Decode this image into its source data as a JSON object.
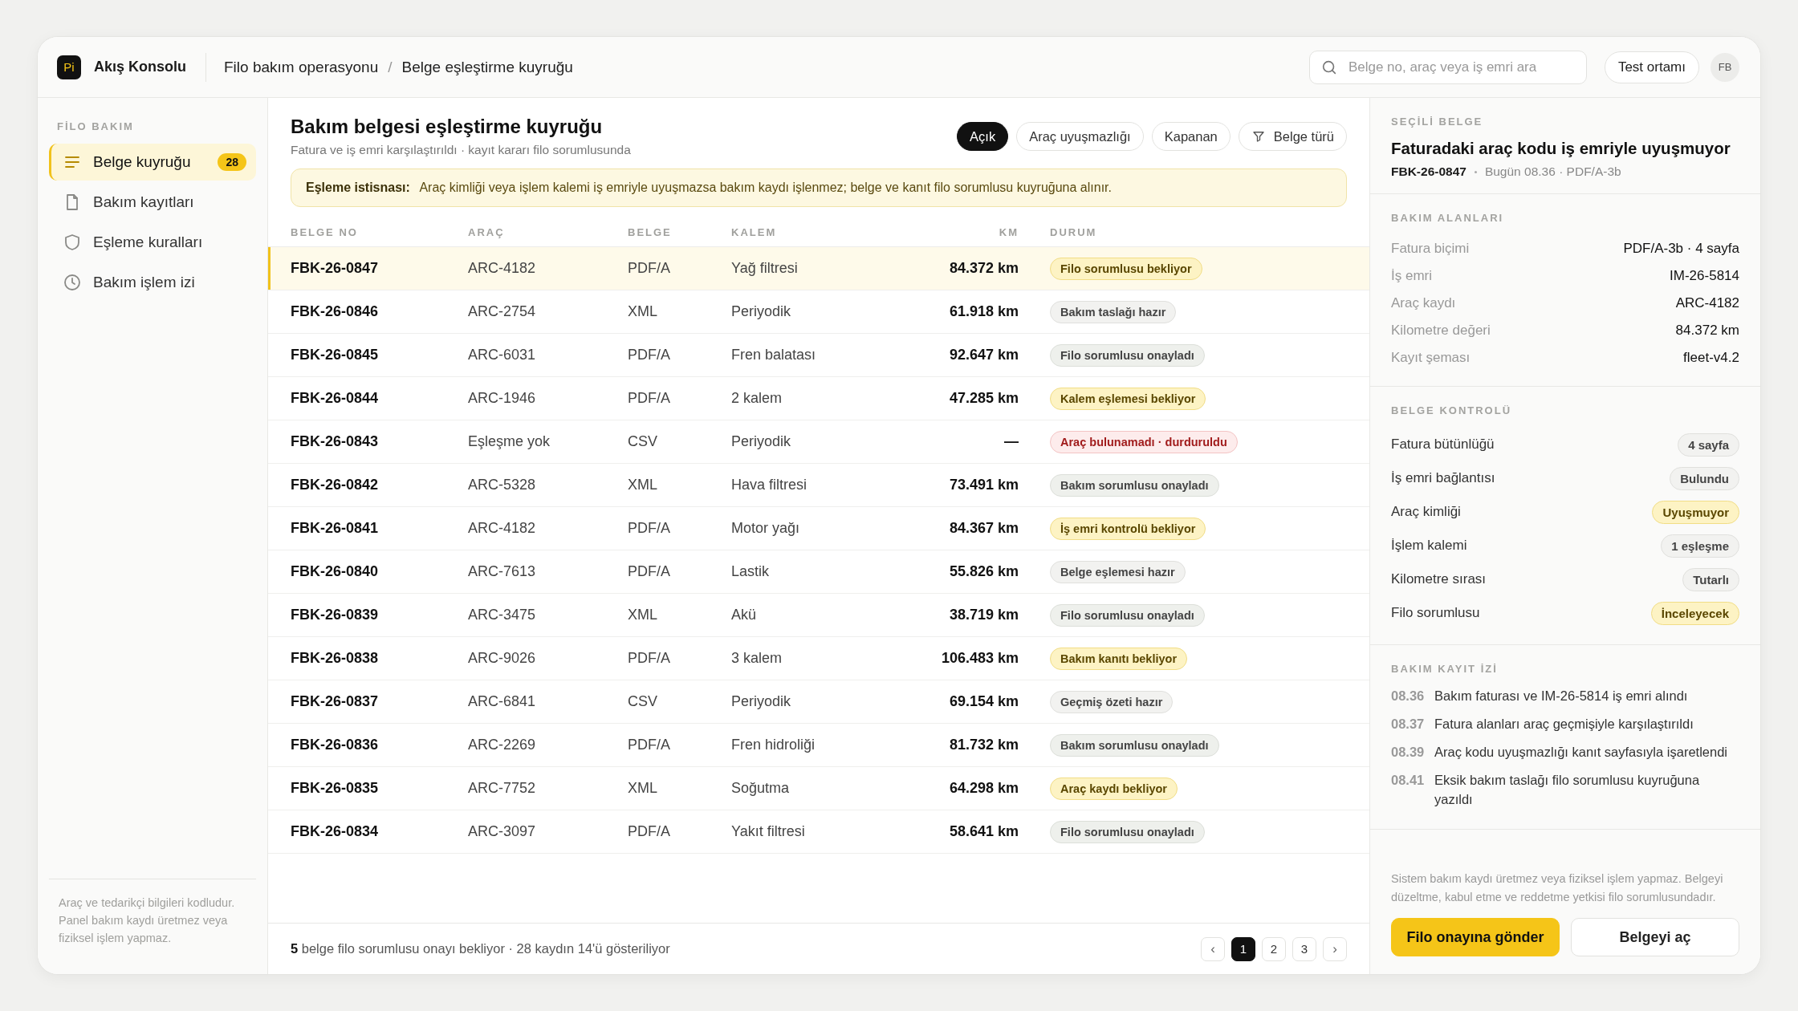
{
  "topbar": {
    "logo": "Pi",
    "app_name": "Akış Konsolu",
    "breadcrumb": [
      {
        "label": "Filo bakım operasyonu"
      },
      {
        "label": "Belge eşleştirme kuyruğu"
      }
    ],
    "breadcrumb_separator": "/",
    "search": {
      "placeholder": "Belge no, araç veya iş emri ara"
    },
    "environment": "Test ortamı",
    "avatar": "FB"
  },
  "sidebar": {
    "section": "FİLO BAKIM",
    "items": [
      {
        "label": "Belge kuyruğu",
        "count": "28",
        "selected": true
      },
      {
        "label": "Bakım kayıtları",
        "selected": false
      },
      {
        "label": "Eşleme kuralları",
        "selected": false
      },
      {
        "label": "Bakım işlem izi",
        "selected": false
      }
    ],
    "note": "Araç ve tedarikçi bilgileri kodludur. Panel bakım kaydı üretmez veya fiziksel işlem yapmaz."
  },
  "main": {
    "title": "Bakım belgesi eşleştirme kuyruğu",
    "subtitle": "Fatura ve iş emri karşılaştırıldı · kayıt kararı filo sorumlusunda",
    "filters": [
      {
        "label": "Açık",
        "selected": true,
        "kind": "chip"
      },
      {
        "label": "Araç uyuşmazlığı",
        "selected": false,
        "kind": "chip"
      },
      {
        "label": "Kapanan",
        "selected": false,
        "kind": "chip"
      },
      {
        "label": "Belge türü",
        "selected": false,
        "kind": "filter"
      }
    ],
    "alert": "**Eşleme istisnası:** Araç kimliği veya işlem kalemi iş emriyle uyuşmazsa bakım kaydı işlenmez; belge ve kanıt filo sorumlusu kuyruğuna alınır.",
    "table": {
      "columns": [
        "BELGE NO",
        "ARAÇ",
        "BELGE",
        "KALEM",
        "KM",
        "DURUM"
      ],
      "rows": [
        {
          "no": "FBK-26-0847",
          "vehicle": "ARC-4182",
          "doc": "PDF/A",
          "item": "Yağ filtresi",
          "km": "84.372 km",
          "status": "Filo sorumlusu bekliyor",
          "kind": "warn",
          "selected": true
        },
        {
          "no": "FBK-26-0846",
          "vehicle": "ARC-2754",
          "doc": "XML",
          "item": "Periyodik",
          "km": "61.918 km",
          "status": "Bakım taslağı hazır",
          "kind": "neutral",
          "selected": false
        },
        {
          "no": "FBK-26-0845",
          "vehicle": "ARC-6031",
          "doc": "PDF/A",
          "item": "Fren balatası",
          "km": "92.647 km",
          "status": "Filo sorumlusu onayladı",
          "kind": "done",
          "selected": false
        },
        {
          "no": "FBK-26-0844",
          "vehicle": "ARC-1946",
          "doc": "PDF/A",
          "item": "2 kalem",
          "km": "47.285 km",
          "status": "Kalem eşlemesi bekliyor",
          "kind": "warn",
          "selected": false
        },
        {
          "no": "FBK-26-0843",
          "vehicle": "Eşleşme yok",
          "doc": "CSV",
          "item": "Periyodik",
          "km": "—",
          "status": "Araç bulunamadı · durduruldu",
          "kind": "danger",
          "selected": false
        },
        {
          "no": "FBK-26-0842",
          "vehicle": "ARC-5328",
          "doc": "XML",
          "item": "Hava filtresi",
          "km": "73.491 km",
          "status": "Bakım sorumlusu onayladı",
          "kind": "done",
          "selected": false
        },
        {
          "no": "FBK-26-0841",
          "vehicle": "ARC-4182",
          "doc": "PDF/A",
          "item": "Motor yağı",
          "km": "84.367 km",
          "status": "İş emri kontrolü bekliyor",
          "kind": "warn",
          "selected": false
        },
        {
          "no": "FBK-26-0840",
          "vehicle": "ARC-7613",
          "doc": "PDF/A",
          "item": "Lastik",
          "km": "55.826 km",
          "status": "Belge eşlemesi hazır",
          "kind": "neutral",
          "selected": false
        },
        {
          "no": "FBK-26-0839",
          "vehicle": "ARC-3475",
          "doc": "XML",
          "item": "Akü",
          "km": "38.719 km",
          "status": "Filo sorumlusu onayladı",
          "kind": "done",
          "selected": false
        },
        {
          "no": "FBK-26-0838",
          "vehicle": "ARC-9026",
          "doc": "PDF/A",
          "item": "3 kalem",
          "km": "106.483 km",
          "status": "Bakım kanıtı bekliyor",
          "kind": "warn",
          "selected": false
        },
        {
          "no": "FBK-26-0837",
          "vehicle": "ARC-6841",
          "doc": "CSV",
          "item": "Periyodik",
          "km": "69.154 km",
          "status": "Geçmiş özeti hazır",
          "kind": "neutral",
          "selected": false
        },
        {
          "no": "FBK-26-0836",
          "vehicle": "ARC-2269",
          "doc": "PDF/A",
          "item": "Fren hidroliği",
          "km": "81.732 km",
          "status": "Bakım sorumlusu onayladı",
          "kind": "done",
          "selected": false
        },
        {
          "no": "FBK-26-0835",
          "vehicle": "ARC-7752",
          "doc": "XML",
          "item": "Soğutma",
          "km": "64.298 km",
          "status": "Araç kaydı bekliyor",
          "kind": "warn",
          "selected": false
        },
        {
          "no": "FBK-26-0834",
          "vehicle": "ARC-3097",
          "doc": "PDF/A",
          "item": "Yakıt filtresi",
          "km": "58.641 km",
          "status": "Filo sorumlusu onayladı",
          "kind": "done",
          "selected": false
        }
      ]
    },
    "footer": "**5** belge filo sorumlusu onayı bekliyor · 28 kaydın 14'ü gösteriliyor",
    "pagination": [
      {
        "label": "‹",
        "kind": "arrow",
        "selected": false
      },
      {
        "label": "1",
        "kind": "page",
        "selected": true
      },
      {
        "label": "2",
        "kind": "page",
        "selected": false
      },
      {
        "label": "3",
        "kind": "page",
        "selected": false
      },
      {
        "label": "›",
        "kind": "arrow",
        "selected": false
      }
    ]
  },
  "detail": {
    "section": "SEÇİLİ BELGE",
    "title": "Faturadaki araç kodu iş emriyle uyuşmuyor",
    "doc_no": "FBK-26-0847",
    "meta": "Bugün 08.36 · PDF/A-3b",
    "fields_title": "BAKIM ALANLARI",
    "fields": [
      {
        "label": "Fatura biçimi",
        "value": "PDF/A-3b · 4 sayfa"
      },
      {
        "label": "İş emri",
        "value": "IM-26-5814"
      },
      {
        "label": "Araç kaydı",
        "value": "ARC-4182"
      },
      {
        "label": "Kilometre değeri",
        "value": "84.372 km"
      },
      {
        "label": "Kayıt şeması",
        "value": "fleet-v4.2"
      }
    ],
    "checks_title": "BELGE KONTROLÜ",
    "checks": [
      {
        "label": "Fatura bütünlüğü",
        "value": "4 sayfa",
        "kind": "neutral"
      },
      {
        "label": "İş emri bağlantısı",
        "value": "Bulundu",
        "kind": "neutral"
      },
      {
        "label": "Araç kimliği",
        "value": "Uyuşmuyor",
        "kind": "warn"
      },
      {
        "label": "İşlem kalemi",
        "value": "1 eşleşme",
        "kind": "neutral"
      },
      {
        "label": "Kilometre sırası",
        "value": "Tutarlı",
        "kind": "neutral"
      },
      {
        "label": "Filo sorumlusu",
        "value": "İnceleyecek",
        "kind": "warn"
      }
    ],
    "log_title": "BAKIM KAYIT İZİ",
    "log": [
      {
        "time": "08.36",
        "text": "Bakım faturası ve IM-26-5814 iş emri alındı"
      },
      {
        "time": "08.37",
        "text": "Fatura alanları araç geçmişiyle karşılaştırıldı"
      },
      {
        "time": "08.39",
        "text": "Araç kodu uyuşmazlığı kanıt sayfasıyla işaretlendi"
      },
      {
        "time": "08.41",
        "text": "Eksik bakım taslağı filo sorumlusu kuyruğuna yazıldı"
      }
    ],
    "note": "Sistem bakım kaydı üretmez veya fiziksel işlem yapmaz. Belgeyi düzeltme, kabul etme ve reddetme yetkisi filo sorumlusundadır.",
    "actions": [
      {
        "label": "Filo onayına gönder",
        "kind": "primary"
      },
      {
        "label": "Belgeyi aç",
        "kind": "secondary"
      }
    ]
  }
}
